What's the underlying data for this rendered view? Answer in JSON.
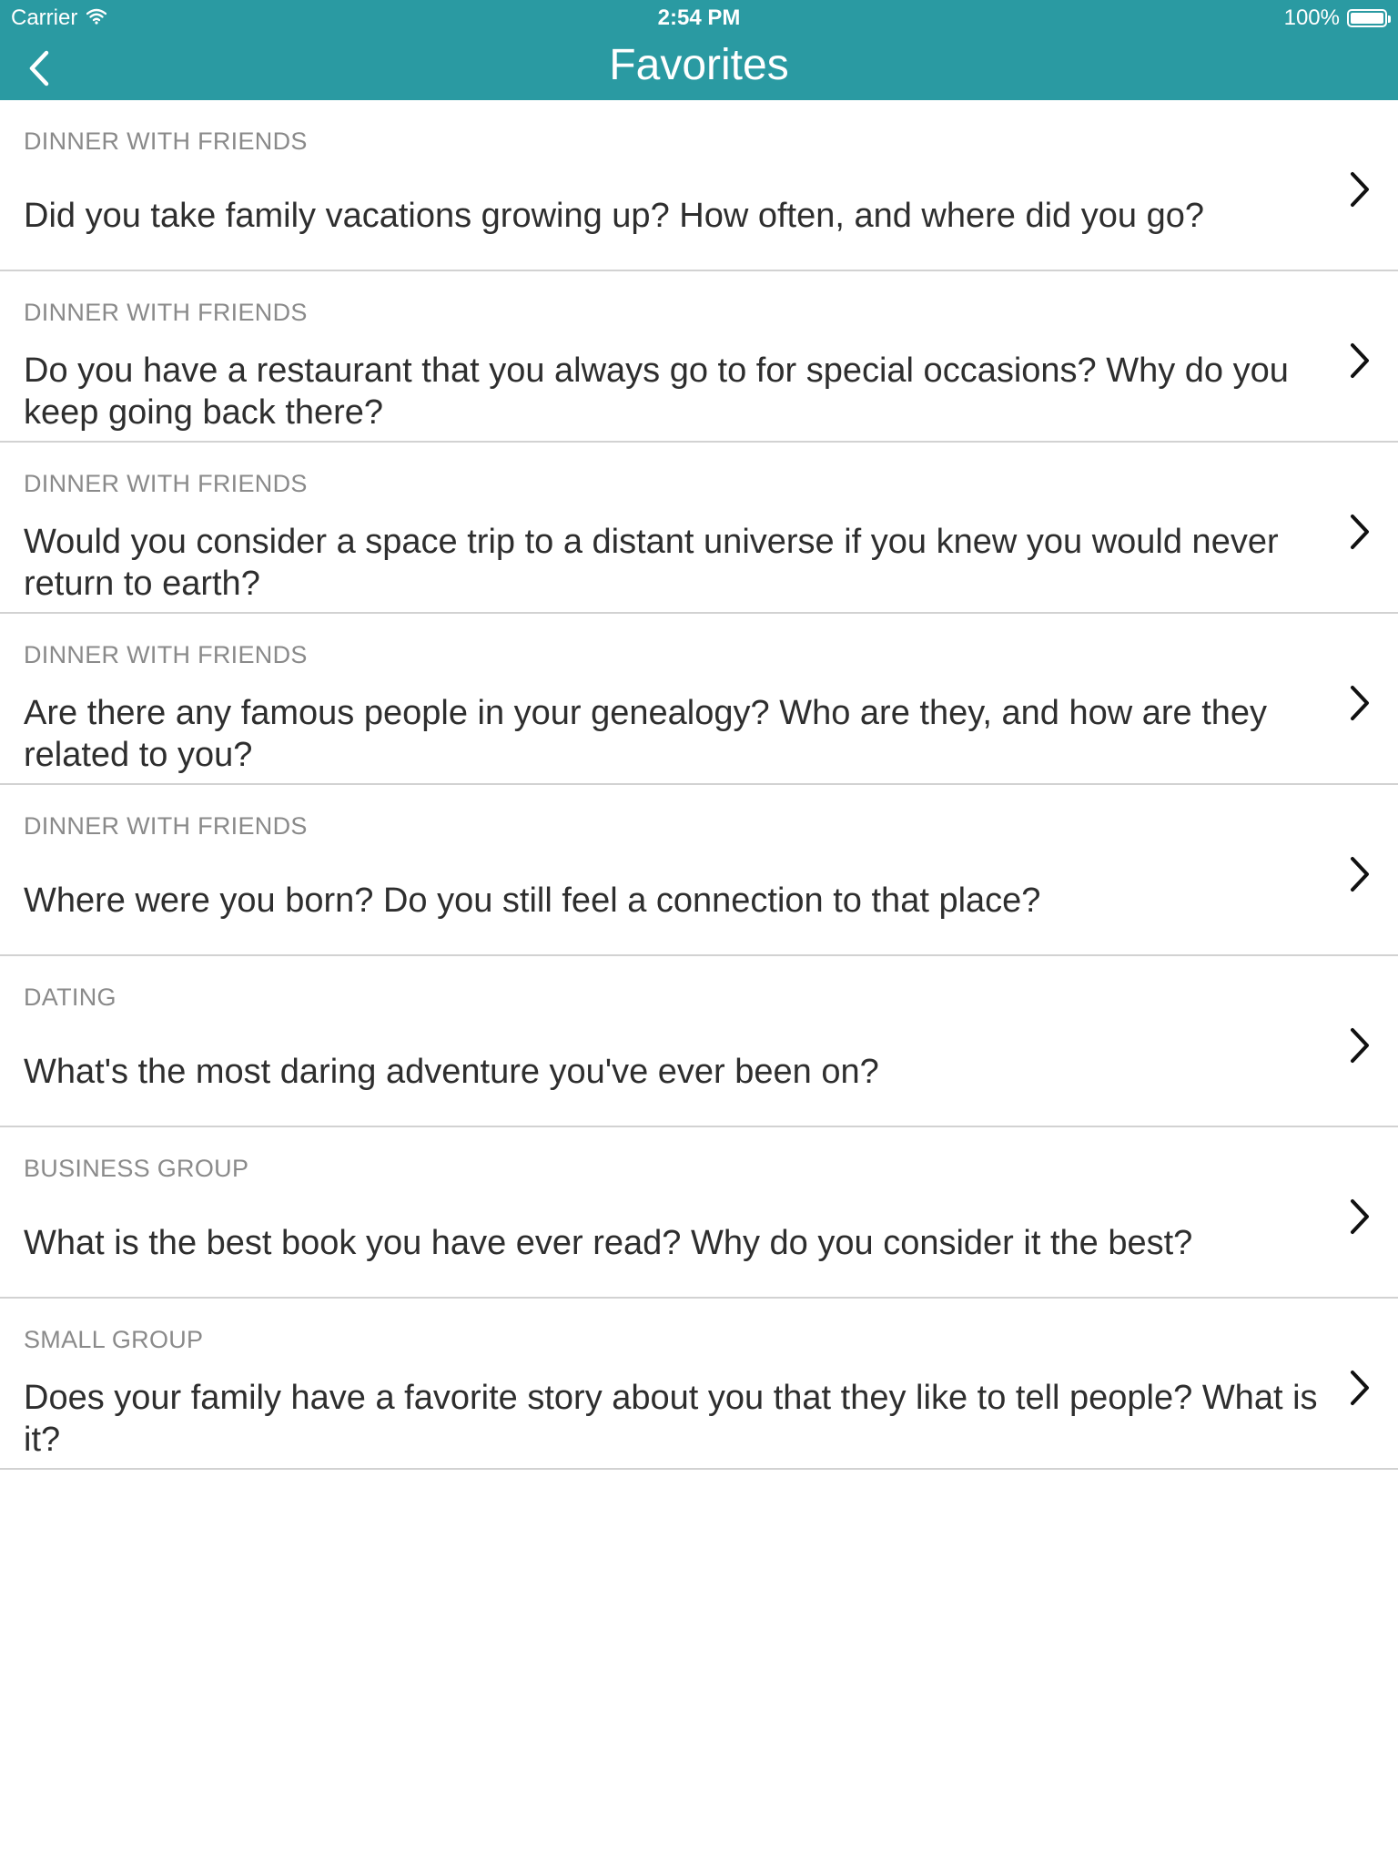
{
  "status_bar": {
    "carrier": "Carrier",
    "time": "2:54 PM",
    "battery_percent": "100%",
    "battery_level": 1.0,
    "icons": [
      "wifi-icon",
      "battery-icon"
    ]
  },
  "nav": {
    "title": "Favorites",
    "back_icon": "chevron-left-icon"
  },
  "colors": {
    "accent": "#2a9aa2",
    "category_text": "#8a8a8a",
    "question_text": "#2e2e2e",
    "divider": "#d2d2d2"
  },
  "favorites": [
    {
      "category": "DINNER WITH FRIENDS",
      "question": "Did you take family vacations growing up? How often, and where did you go?"
    },
    {
      "category": "DINNER WITH FRIENDS",
      "question": "Do you have a restaurant that you always go to for special occasions? Why do you keep going back there?"
    },
    {
      "category": "DINNER WITH FRIENDS",
      "question": "Would you consider a space trip to a distant universe if you knew you would never return to earth?"
    },
    {
      "category": "DINNER WITH FRIENDS",
      "question": "Are there any famous people in your genealogy? Who are they, and how are they related to you?"
    },
    {
      "category": "DINNER WITH FRIENDS",
      "question": "Where were you born? Do you still feel a connection to that place?"
    },
    {
      "category": "DATING",
      "question": "What's the most daring adventure you've ever been on?"
    },
    {
      "category": "BUSINESS GROUP",
      "question": "What is the best book you have ever read? Why do you consider it the best?"
    },
    {
      "category": "SMALL GROUP",
      "question": "Does your family have a favorite story about you that they like to tell people? What is it?"
    }
  ]
}
